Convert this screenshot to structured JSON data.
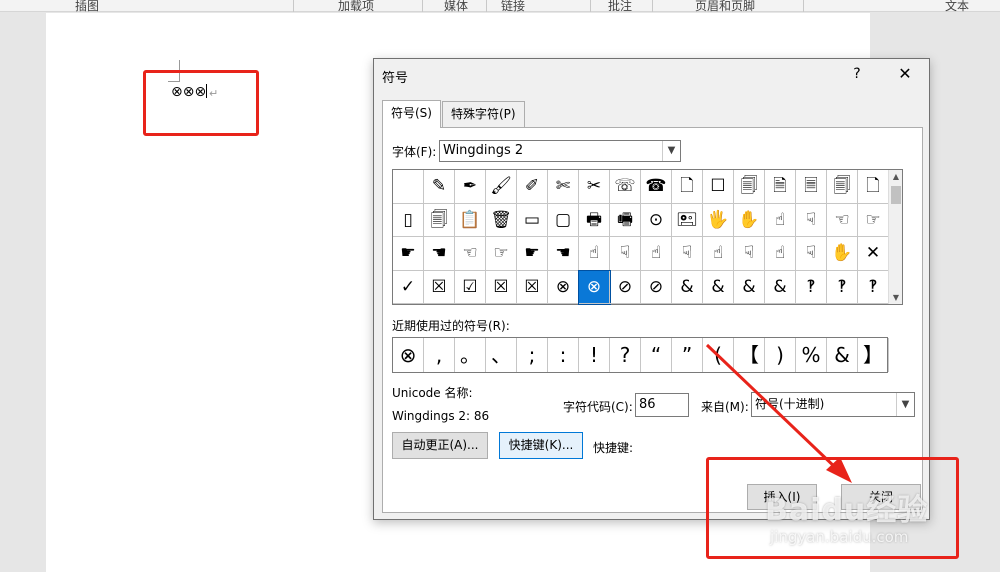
{
  "ribbon": {
    "groups": [
      "插图",
      "加载项",
      "媒体",
      "链接",
      "批注",
      "页眉和页脚",
      "文本"
    ]
  },
  "document": {
    "text": "⊗⊗⊗",
    "paragraph_mark": "↵"
  },
  "dialog": {
    "title": "符号",
    "help": "?",
    "close": "✕",
    "tabs": [
      {
        "label": "符号(S)",
        "active": true
      },
      {
        "label": "特殊字符(P)",
        "active": false
      }
    ],
    "font_label": "字体(F):",
    "font_value": "Wingdings 2",
    "symbols": [
      "",
      "✎",
      "✒",
      "🖌",
      "✐",
      "✄",
      "✂",
      "☏",
      "☎",
      "🗋",
      "☐",
      "🗐",
      "🗎",
      "🗏",
      "🗐",
      "🗋",
      "▯",
      "🗐",
      "📋",
      "🗑",
      "▭",
      "▢",
      "🖶",
      "🖷",
      "⊙",
      "🖭",
      "🖐",
      "✋",
      "☝",
      "☟",
      "☜",
      "☞",
      "☛",
      "☚",
      "☜",
      "☞",
      "☛",
      "☚",
      "☝",
      "☟",
      "☝",
      "☟",
      "☝",
      "☟",
      "☝",
      "☟",
      "✋",
      "✕",
      "✓",
      "☒",
      "☑",
      "☒",
      "☒",
      "⊗",
      "⊗",
      "⊘",
      "⊘",
      "&",
      "&",
      "&",
      "&",
      "‽",
      "‽",
      "‽"
    ],
    "selected_index": 54,
    "recent_label": "近期使用过的符号(R):",
    "recent": [
      "⊗",
      ",",
      "。",
      "、",
      ";",
      ":",
      "!",
      "?",
      "“",
      "”",
      "(",
      "【",
      ")",
      "%",
      "&",
      "】"
    ],
    "unicode_name_label": "Unicode 名称:",
    "unicode_name_value": "Wingdings 2: 86",
    "char_code_label": "字符代码(C):",
    "char_code_value": "86",
    "from_label": "来自(M):",
    "from_value": "符号(十进制)",
    "autocorrect_button": "自动更正(A)...",
    "shortcut_button": "快捷键(K)...",
    "shortcut_text": "快捷键:",
    "insert_button": "插入(I)",
    "close_button": "关闭"
  },
  "watermark": {
    "brand": "Baidu经验",
    "url": "jingyan.baidu.com"
  },
  "colors": {
    "highlight_red": "#e8231a",
    "selection_blue": "#0a78d7"
  }
}
